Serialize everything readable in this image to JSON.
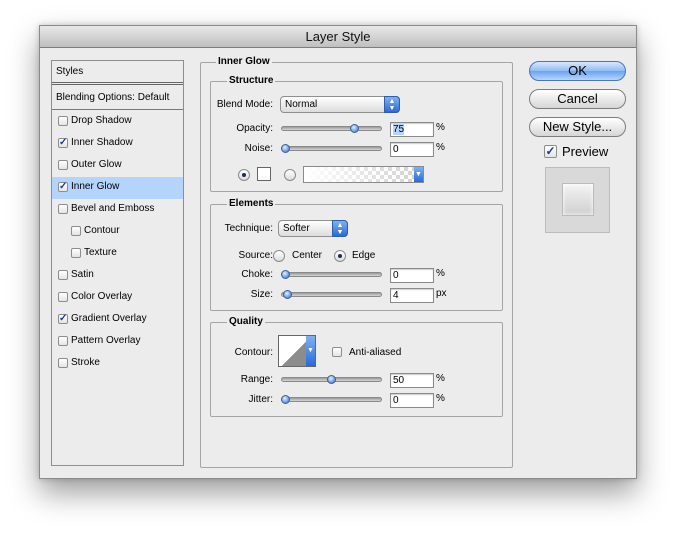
{
  "window": {
    "title": "Layer Style"
  },
  "styles_panel": {
    "header": "Styles",
    "blending_options": "Blending Options: Default",
    "items": [
      {
        "label": "Drop Shadow",
        "checked": false,
        "selected": false,
        "sub": false
      },
      {
        "label": "Inner Shadow",
        "checked": true,
        "selected": false,
        "sub": false
      },
      {
        "label": "Outer Glow",
        "checked": false,
        "selected": false,
        "sub": false
      },
      {
        "label": "Inner Glow",
        "checked": true,
        "selected": true,
        "sub": false
      },
      {
        "label": "Bevel and Emboss",
        "checked": false,
        "selected": false,
        "sub": false
      },
      {
        "label": "Contour",
        "checked": false,
        "selected": false,
        "sub": true
      },
      {
        "label": "Texture",
        "checked": false,
        "selected": false,
        "sub": true
      },
      {
        "label": "Satin",
        "checked": false,
        "selected": false,
        "sub": false
      },
      {
        "label": "Color Overlay",
        "checked": false,
        "selected": false,
        "sub": false
      },
      {
        "label": "Gradient Overlay",
        "checked": true,
        "selected": false,
        "sub": false
      },
      {
        "label": "Pattern Overlay",
        "checked": false,
        "selected": false,
        "sub": false
      },
      {
        "label": "Stroke",
        "checked": false,
        "selected": false,
        "sub": false
      }
    ]
  },
  "inner_glow": {
    "title": "Inner Glow",
    "structure": {
      "title": "Structure",
      "blend_mode_label": "Blend Mode:",
      "blend_mode_value": "Normal",
      "opacity_label": "Opacity:",
      "opacity_value": "75",
      "opacity_unit": "%",
      "opacity_level": 0.75,
      "noise_label": "Noise:",
      "noise_value": "0",
      "noise_unit": "%",
      "noise_level": 0
    },
    "elements": {
      "title": "Elements",
      "technique_label": "Technique:",
      "technique_value": "Softer",
      "source_label": "Source:",
      "source_center": "Center",
      "source_edge": "Edge",
      "source_selected": "Edge",
      "choke_label": "Choke:",
      "choke_value": "0",
      "choke_unit": "%",
      "choke_level": 0,
      "size_label": "Size:",
      "size_value": "4",
      "size_unit": "px",
      "size_level": 0.02
    },
    "quality": {
      "title": "Quality",
      "contour_label": "Contour:",
      "anti_aliased_label": "Anti-aliased",
      "anti_aliased": false,
      "range_label": "Range:",
      "range_value": "50",
      "range_unit": "%",
      "range_level": 0.5,
      "jitter_label": "Jitter:",
      "jitter_value": "0",
      "jitter_unit": "%",
      "jitter_level": 0
    }
  },
  "buttons": {
    "ok": "OK",
    "cancel": "Cancel",
    "new_style": "New Style...",
    "preview_label": "Preview",
    "preview_checked": true
  },
  "colors": {
    "selection": "#b5d4fc",
    "aqua_blue": "#2a6ad6"
  }
}
